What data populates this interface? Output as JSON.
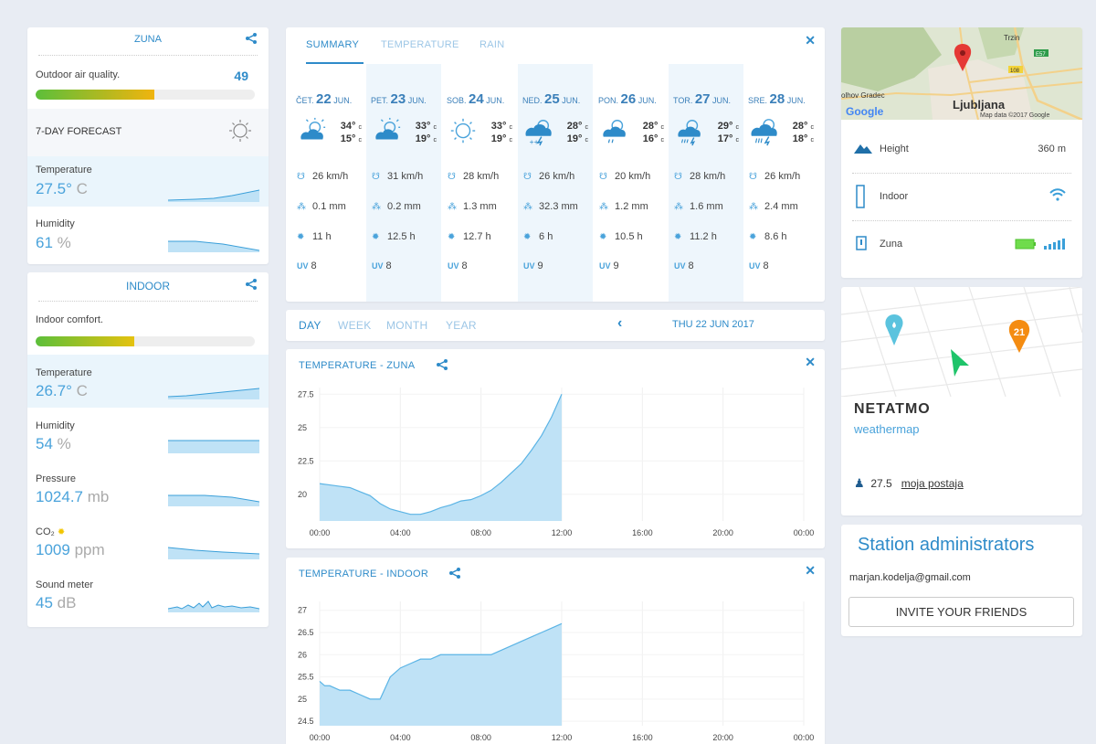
{
  "outdoor": {
    "name": "ZUNA",
    "air_quality_label": "Outdoor air quality.",
    "air_quality_value": "49",
    "air_quality_level": 0.54,
    "forecast_label": "7-DAY FORECAST",
    "temp_label": "Temperature",
    "temp_value": "27.5°",
    "temp_unit": "C",
    "hum_label": "Humidity",
    "hum_value": "61",
    "hum_unit": "%"
  },
  "indoor": {
    "name": "INDOOR",
    "comfort_label": "Indoor comfort.",
    "comfort_level": 0.45,
    "temp_label": "Temperature",
    "temp_value": "26.7°",
    "temp_unit": "C",
    "hum_label": "Humidity",
    "hum_value": "54",
    "hum_unit": "%",
    "pressure_label": "Pressure",
    "pressure_value": "1024.7",
    "pressure_unit": "mb",
    "co2_label": "CO₂",
    "co2_value": "1009",
    "co2_unit": "ppm",
    "sound_label": "Sound meter",
    "sound_value": "45",
    "sound_unit": "dB"
  },
  "forecast": {
    "tabs": [
      "SUMMARY",
      "TEMPERATURE",
      "RAIN"
    ],
    "days": [
      {
        "dow": "ČET.",
        "num": "22",
        "mon": "JUN.",
        "max": "34°",
        "min": "15°",
        "icon": "sun-cloud",
        "wind": "26 km/h",
        "rain": "0.1 mm",
        "sun": "11 h",
        "uv": "8"
      },
      {
        "dow": "PET.",
        "num": "23",
        "mon": "JUN.",
        "max": "33°",
        "min": "19°",
        "icon": "sun-cloud",
        "wind": "31 km/h",
        "rain": "0.2 mm",
        "sun": "12.5 h",
        "uv": "8"
      },
      {
        "dow": "SOB.",
        "num": "24",
        "mon": "JUN.",
        "max": "33°",
        "min": "19°",
        "icon": "sun",
        "wind": "28 km/h",
        "rain": "1.3 mm",
        "sun": "12.7 h",
        "uv": "8"
      },
      {
        "dow": "NED.",
        "num": "25",
        "mon": "JUN.",
        "max": "28°",
        "min": "19°",
        "icon": "storm-snow",
        "wind": "26 km/h",
        "rain": "32.3 mm",
        "sun": "6 h",
        "uv": "9"
      },
      {
        "dow": "PON.",
        "num": "26",
        "mon": "JUN.",
        "max": "28°",
        "min": "16°",
        "icon": "sun-cloud-rain",
        "wind": "20 km/h",
        "rain": "1.2 mm",
        "sun": "10.5 h",
        "uv": "9"
      },
      {
        "dow": "TOR.",
        "num": "27",
        "mon": "JUN.",
        "max": "29°",
        "min": "17°",
        "icon": "sun-storm",
        "wind": "28 km/h",
        "rain": "1.6 mm",
        "sun": "11.2 h",
        "uv": "8"
      },
      {
        "dow": "SRE.",
        "num": "28",
        "mon": "JUN.",
        "max": "28°",
        "min": "18°",
        "icon": "storm-rain",
        "wind": "26 km/h",
        "rain": "2.4 mm",
        "sun": "8.6 h",
        "uv": "8"
      }
    ],
    "temp_unit": "c",
    "uv_label": "UV"
  },
  "period": {
    "tabs": [
      "DAY",
      "WEEK",
      "MONTH",
      "YEAR"
    ],
    "date": "THU 22 JUN 2017"
  },
  "chart_data": [
    {
      "type": "area",
      "title": "TEMPERATURE - ZUNA",
      "x_ticks": [
        "00:00",
        "04:00",
        "08:00",
        "12:00",
        "16:00",
        "20:00",
        "00:00"
      ],
      "y_ticks": [
        "27.5",
        "25",
        "22.5",
        "20"
      ],
      "ylim": [
        18,
        28
      ],
      "x": [
        0,
        0.5,
        1,
        1.5,
        2,
        2.5,
        3,
        3.5,
        4,
        4.5,
        5,
        5.5,
        6,
        6.5,
        7,
        7.5,
        8,
        8.5,
        9,
        9.5,
        10,
        10.5,
        11,
        11.5,
        12
      ],
      "y": [
        20.8,
        20.7,
        20.6,
        20.5,
        20.2,
        19.9,
        19.3,
        18.9,
        18.7,
        18.5,
        18.5,
        18.7,
        19.0,
        19.2,
        19.5,
        19.6,
        19.9,
        20.3,
        20.9,
        21.6,
        22.3,
        23.3,
        24.4,
        25.8,
        27.5
      ],
      "grid": true
    },
    {
      "type": "area",
      "title": "TEMPERATURE - INDOOR",
      "x_ticks": [
        "00:00",
        "04:00",
        "08:00",
        "12:00",
        "16:00",
        "20:00",
        "00:00"
      ],
      "y_ticks": [
        "27",
        "26.5",
        "26",
        "25.5",
        "25",
        "24.5"
      ],
      "ylim": [
        24.4,
        27.2
      ],
      "x": [
        0,
        0.25,
        0.5,
        1,
        1.5,
        2,
        2.5,
        3,
        3.5,
        4,
        4.5,
        5,
        5.5,
        6,
        6.5,
        7,
        7.5,
        8,
        8.5,
        9,
        9.5,
        10,
        10.5,
        11,
        11.5,
        12
      ],
      "y": [
        25.4,
        25.3,
        25.3,
        25.2,
        25.2,
        25.1,
        25.0,
        25.0,
        25.5,
        25.7,
        25.8,
        25.9,
        25.9,
        26.0,
        26.0,
        26.0,
        26.0,
        26.0,
        26.0,
        26.1,
        26.2,
        26.3,
        26.4,
        26.5,
        26.6,
        26.7
      ],
      "grid": true
    }
  ],
  "map": {
    "labels": [
      "Trzin",
      "Ljubljana",
      "olhov Gradec",
      "E57",
      "108"
    ],
    "google": "Google",
    "attribution": "Map data ©2017 Google"
  },
  "station": {
    "height_label": "Height",
    "height_value": "360 m",
    "indoor_label": "Indoor",
    "outdoor_label": "Zuna"
  },
  "weathermap": {
    "brand": "NETATMO",
    "sub": "weathermap",
    "pin_count": "21",
    "temp": "27.5",
    "station_link": "moja postaja"
  },
  "admins": {
    "title": "Station administrators",
    "email": "marjan.kodelja@gmail.com",
    "invite": "INVITE YOUR FRIENDS"
  },
  "colors": {
    "accent": "#2e8bc9",
    "area_fill": "#bfe2f6",
    "area_line": "#5bb4e5",
    "gauge_start": "#5cbf3a",
    "gauge_end": "#f0b40e"
  }
}
